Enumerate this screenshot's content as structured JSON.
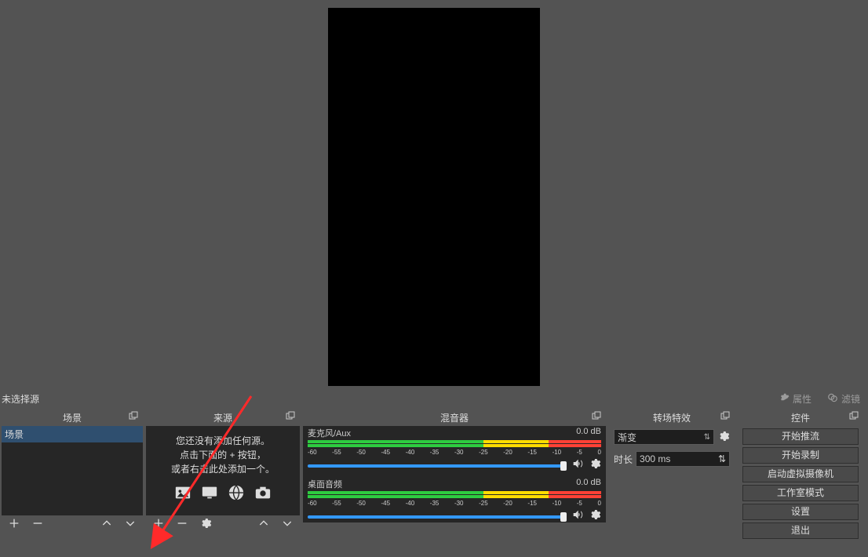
{
  "toolbar": {
    "no_source_selected": "未选择源",
    "properties": "属性",
    "filters": "滤镜"
  },
  "panels": {
    "scenes": {
      "title": "场景",
      "item": "场景"
    },
    "sources": {
      "title": "来源",
      "empty1": "您还没有添加任何源。",
      "empty2": "点击下面的 + 按钮，",
      "empty3": "或者右击此处添加一个。"
    },
    "mixer": {
      "title": "混音器",
      "mic": "麦克风/Aux",
      "desktop": "桌面音频",
      "level": "0.0 dB",
      "ticks": [
        "-60",
        "-55",
        "-50",
        "-45",
        "-40",
        "-35",
        "-30",
        "-25",
        "-20",
        "-15",
        "-10",
        "-5",
        "0"
      ]
    },
    "transitions": {
      "title": "转场特效",
      "mode": "渐变",
      "duration_label": "时长",
      "duration_value": "300 ms"
    },
    "controls": {
      "title": "控件",
      "start_stream": "开始推流",
      "start_record": "开始录制",
      "start_vcam": "启动虚拟摄像机",
      "studio_mode": "工作室模式",
      "settings": "设置",
      "exit": "退出"
    }
  }
}
